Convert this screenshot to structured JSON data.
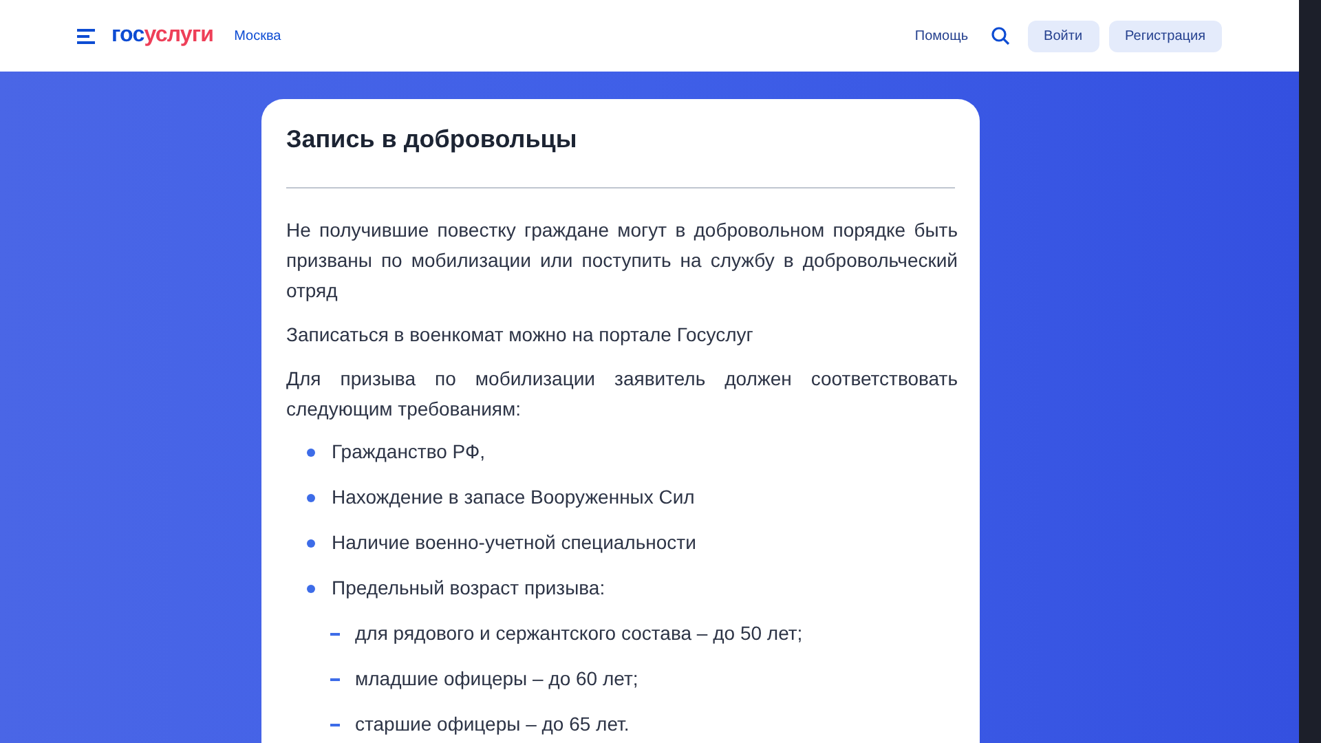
{
  "header": {
    "logo": [
      {
        "text": "гос",
        "color": "#0d4cd3"
      },
      {
        "text": "услуги",
        "color": "#ee3f58"
      }
    ],
    "region": "Москва",
    "help": "Помощь",
    "login": "Войти",
    "register": "Регистрация"
  },
  "card": {
    "title": "Запись в добровольцы",
    "paragraphs": [
      "Не получившие повестку граждане могут в добровольном порядке быть призваны по мобилизации или поступить на службу в добровольческий отряд",
      "Записаться в военкомат можно на портале Госуслуг",
      "Для призыва по мобилизации заявитель должен соответствовать следующим требованиям:"
    ],
    "requirements": [
      {
        "text": "Гражданство РФ,"
      },
      {
        "text": "Нахождение в запасе Вооруженных Сил"
      },
      {
        "text": "Наличие военно-учетной специальности"
      },
      {
        "text": "Предельный возраст призыва:",
        "children": [
          {
            "text": "для рядового и сержантского состава – до 50 лет;"
          },
          {
            "text": "младшие офицеры – до 60 лет;"
          },
          {
            "text": "старшие офицеры – до 65 лет."
          }
        ]
      }
    ]
  }
}
